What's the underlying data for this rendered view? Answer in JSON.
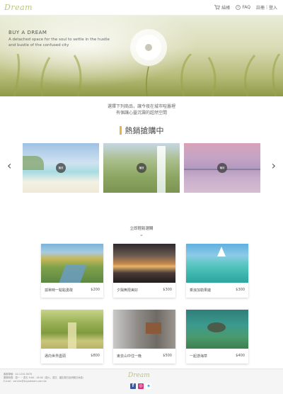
{
  "header": {
    "logo": "Dream",
    "cart_label": "結帳",
    "faq_label": "FAQ",
    "register_label": "註冊",
    "separator": "|",
    "login_label": "登入"
  },
  "hero": {
    "title": "BUY A DREAM",
    "subtitle": "A detached space for the soul to settle in the hustle and bustle of the confused city"
  },
  "intro": {
    "line1": "選擇下列商品，讓今夜在城市喧囂裡",
    "line2": "有個讓心靈沉澱的超然空間"
  },
  "hot": {
    "title": "熱銷搶購中",
    "slides": [
      {
        "play_label": "播放"
      },
      {
        "play_label": "播放"
      },
      {
        "play_label": "播放"
      }
    ]
  },
  "scroll_hint": "立即輕鬆選購",
  "products": [
    {
      "name": "孤單時一點點勇敢",
      "price": "$200"
    },
    {
      "name": "夕陽無限美好",
      "price": "$300"
    },
    {
      "name": "乘浪加勒果鏈",
      "price": "$300"
    },
    {
      "name": "邁向世界盡頭",
      "price": "$800"
    },
    {
      "name": "東去山中住一晚",
      "price": "$500"
    },
    {
      "name": "一起游海草",
      "price": "$400"
    }
  ],
  "footer": {
    "logo": "Dream",
    "info_lines": [
      "客服專線：02-1234-5678",
      "服務時間：週一 ~ 週五 9:00 - 18:00（週六、週日、國定假日及例假日休息）",
      "E-mail：service@buyadream.com.tw"
    ]
  },
  "colors": {
    "accent": "#e3b64d",
    "logo": "#b8c77a",
    "facebook": "#3b5998",
    "instagram": "#d6317f",
    "twitter": "#1da1f2"
  }
}
